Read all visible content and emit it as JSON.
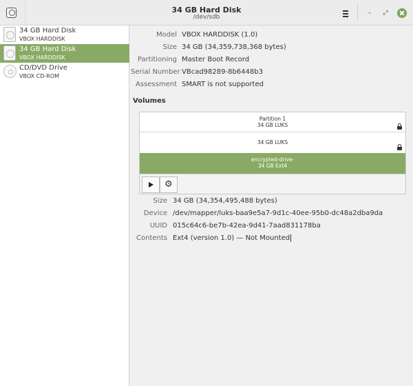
{
  "window": {
    "title": "34 GB Hard Disk",
    "subtitle": "/dev/sdb",
    "minimize_glyph": "–",
    "restore_glyph": "⤢",
    "icons": [
      "disks-app-icon",
      "hamburger-menu-icon",
      "minimize-icon",
      "restore-icon",
      "close-icon"
    ]
  },
  "sidebar": {
    "items": [
      {
        "name": "34 GB Hard Disk",
        "model": "VBOX HARDDISK",
        "icon": "hard-disk-icon",
        "selected": false
      },
      {
        "name": "34 GB Hard Disk",
        "model": "VBOX HARDDISK",
        "icon": "hard-disk-icon",
        "selected": true
      },
      {
        "name": "CD/DVD Drive",
        "model": "VBOX CD-ROM",
        "icon": "optical-drive-icon",
        "selected": false
      }
    ]
  },
  "drive": {
    "model_label": "Model",
    "model": "VBOX HARDDISK (1.0)",
    "size_label": "Size",
    "size": "34 GB (34,359,738,368 bytes)",
    "partitioning_label": "Partitioning",
    "partitioning": "Master Boot Record",
    "serial_label": "Serial Number",
    "serial": "VBcad98289-8b6448b3",
    "assessment_label": "Assessment",
    "assessment": "SMART is not supported"
  },
  "volumes": {
    "title": "Volumes",
    "partition1": {
      "name": "Partition 1",
      "detail": "34 GB LUKS"
    },
    "luks": {
      "detail": "34 GB LUKS"
    },
    "encrypted": {
      "name": "encrypted-drive-",
      "detail": "34 GB Ext4"
    },
    "toolbar": {
      "play_icon": "play-icon",
      "settings_icon": "gears-icon",
      "gear_glyph": "⚙"
    }
  },
  "volume_details": {
    "size_label": "Size",
    "size": "34 GB (34,354,495,488 bytes)",
    "device_label": "Device",
    "device": "/dev/mapper/luks-baa9e5a7-9d1c-40ee-95b0-dc48a2dba9da",
    "uuid_label": "UUID",
    "uuid": "015c64c6-be7b-42ea-9d41-7aad831178ba",
    "contents_label": "Contents",
    "contents": "Ext4 (version 1.0) — Not Mounted"
  },
  "colors": {
    "accent": "#89aa64",
    "close": "#7aa659"
  }
}
